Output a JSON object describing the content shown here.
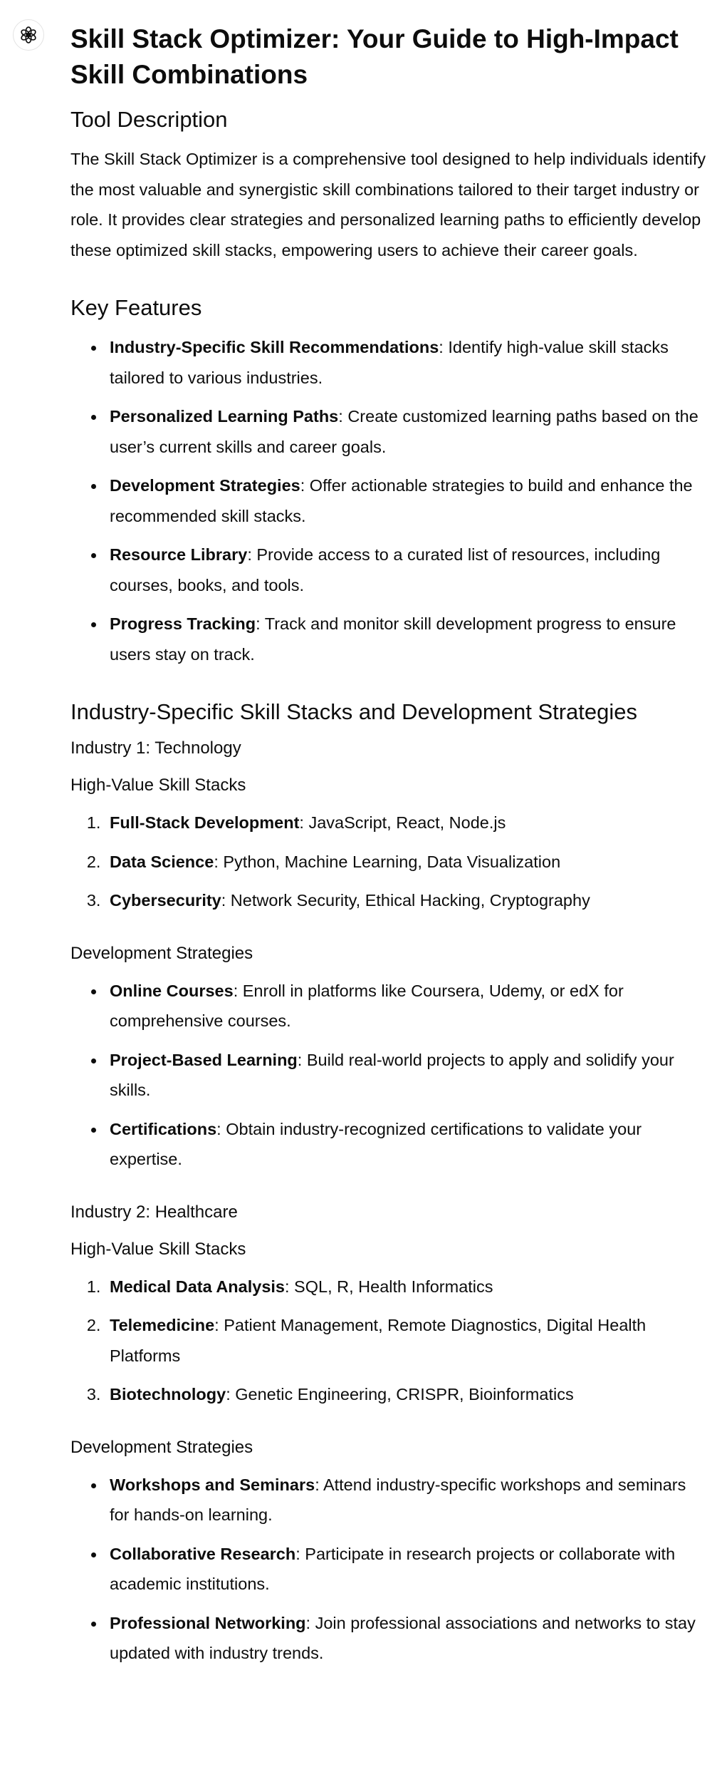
{
  "avatar_icon": "openai-logo-icon",
  "title": "Skill Stack Optimizer: Your Guide to High-Impact Skill Combinations",
  "tool_description": {
    "heading": "Tool Description",
    "text": "The Skill Stack Optimizer is a comprehensive tool designed to help individuals identify the most valuable and synergistic skill combinations tailored to their target industry or role. It provides clear strategies and personalized learning paths to efficiently develop these optimized skill stacks, empowering users to achieve their career goals."
  },
  "key_features": {
    "heading": "Key Features",
    "items": [
      {
        "term": "Industry-Specific Skill Recommendations",
        "desc": ": Identify high-value skill stacks tailored to various industries."
      },
      {
        "term": "Personalized Learning Paths",
        "desc": ": Create customized learning paths based on the user’s current skills and career goals."
      },
      {
        "term": "Development Strategies",
        "desc": ": Offer actionable strategies to build and enhance the recommended skill stacks."
      },
      {
        "term": "Resource Library",
        "desc": ": Provide access to a curated list of resources, including courses, books, and tools."
      },
      {
        "term": "Progress Tracking",
        "desc": ": Track and monitor skill development progress to ensure users stay on track."
      }
    ]
  },
  "industries_section": {
    "heading": "Industry-Specific Skill Stacks and Development Strategies",
    "industries": [
      {
        "name": "Industry 1: Technology",
        "stacks_heading": "High-Value Skill Stacks",
        "stacks": [
          {
            "term": "Full-Stack Development",
            "desc": ": JavaScript, React, Node.js"
          },
          {
            "term": "Data Science",
            "desc": ": Python, Machine Learning, Data Visualization"
          },
          {
            "term": "Cybersecurity",
            "desc": ": Network Security, Ethical Hacking, Cryptography"
          }
        ],
        "strategies_heading": "Development Strategies",
        "strategies": [
          {
            "term": "Online Courses",
            "desc": ": Enroll in platforms like Coursera, Udemy, or edX for comprehensive courses."
          },
          {
            "term": "Project-Based Learning",
            "desc": ": Build real-world projects to apply and solidify your skills."
          },
          {
            "term": "Certifications",
            "desc": ": Obtain industry-recognized certifications to validate your expertise."
          }
        ]
      },
      {
        "name": "Industry 2: Healthcare",
        "stacks_heading": "High-Value Skill Stacks",
        "stacks": [
          {
            "term": "Medical Data Analysis",
            "desc": ": SQL, R, Health Informatics"
          },
          {
            "term": "Telemedicine",
            "desc": ": Patient Management, Remote Diagnostics, Digital Health Platforms"
          },
          {
            "term": "Biotechnology",
            "desc": ": Genetic Engineering, CRISPR, Bioinformatics"
          }
        ],
        "strategies_heading": "Development Strategies",
        "strategies": [
          {
            "term": "Workshops and Seminars",
            "desc": ": Attend industry-specific workshops and seminars for hands-on learning."
          },
          {
            "term": "Collaborative Research",
            "desc": ": Participate in research projects or collaborate with academic institutions."
          },
          {
            "term": "Professional Networking",
            "desc": ": Join professional associations and networks to stay updated with industry trends."
          }
        ]
      }
    ]
  }
}
